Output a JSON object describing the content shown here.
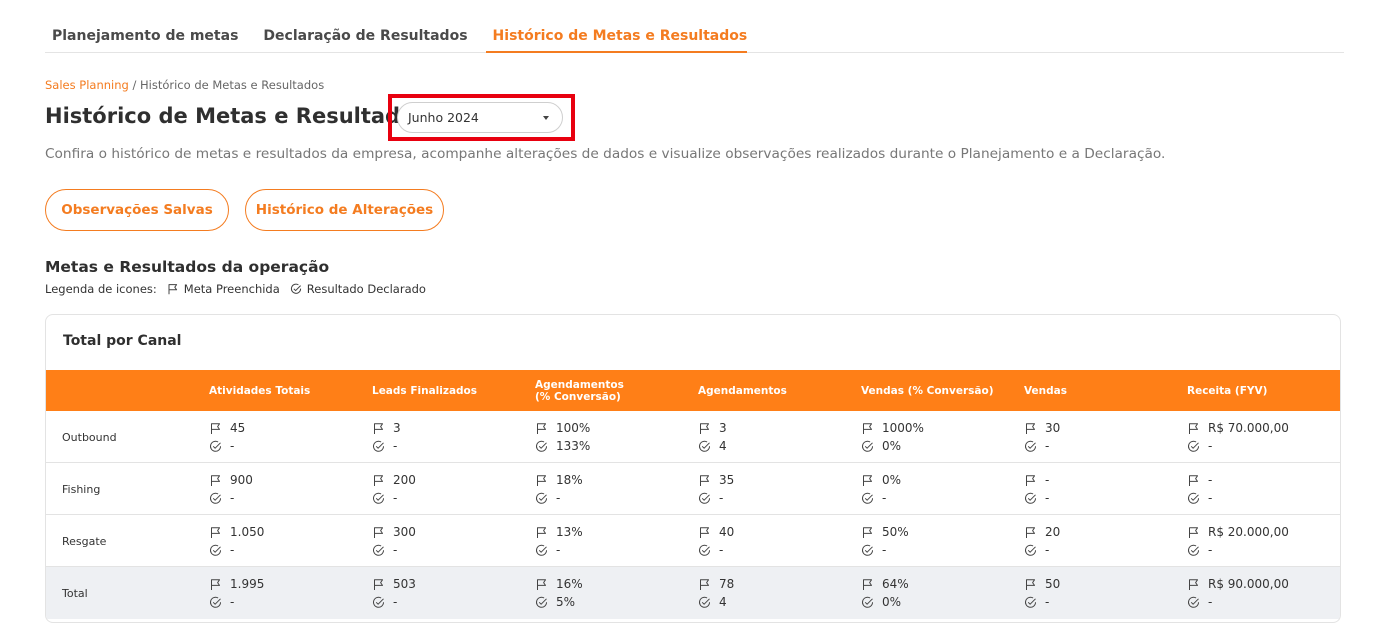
{
  "tabs": [
    {
      "label": "Planejamento de metas",
      "active": false
    },
    {
      "label": "Declaração de Resultados",
      "active": false
    },
    {
      "label": "Histórico de Metas e Resultados",
      "active": true
    }
  ],
  "breadcrumb": {
    "link": "Sales Planning",
    "separator": " / ",
    "current": "Histórico de Metas e Resultados"
  },
  "page": {
    "title": "Histórico de Metas e Resultados",
    "period_select": {
      "value": "Junho 2024"
    },
    "subtitle": "Confira o histórico de metas e resultados da empresa, acompanhe alterações de dados e visualize observações realizados durante o Planejamento e a Declaração."
  },
  "buttons": {
    "observacoes": "Observações Salvas",
    "historico": "Histórico de Alterações"
  },
  "section": {
    "title": "Metas e Resultados da operação",
    "legend_label": "Legenda de icones:",
    "legend_meta": "Meta Preenchida",
    "legend_resultado": "Resultado Declarado"
  },
  "table": {
    "title": "Total por Canal",
    "columns": [
      "Atividades Totais",
      "Leads Finalizados",
      [
        "Agendamentos",
        "(% Conversão)"
      ],
      "Agendamentos",
      "Vendas (% Conversão)",
      "Vendas",
      "Receita (FYV)"
    ],
    "rows": [
      {
        "label": "Outbound",
        "cells": [
          {
            "meta": "45",
            "resultado": "-"
          },
          {
            "meta": "3",
            "resultado": "-"
          },
          {
            "meta": "100%",
            "resultado": "133%"
          },
          {
            "meta": "3",
            "resultado": "4"
          },
          {
            "meta": "1000%",
            "resultado": "0%"
          },
          {
            "meta": "30",
            "resultado": "-"
          },
          {
            "meta": "R$ 70.000,00",
            "resultado": "-"
          }
        ]
      },
      {
        "label": "Fishing",
        "cells": [
          {
            "meta": "900",
            "resultado": "-"
          },
          {
            "meta": "200",
            "resultado": "-"
          },
          {
            "meta": "18%",
            "resultado": "-"
          },
          {
            "meta": "35",
            "resultado": "-"
          },
          {
            "meta": "0%",
            "resultado": "-"
          },
          {
            "meta": "-",
            "resultado": "-"
          },
          {
            "meta": "-",
            "resultado": "-"
          }
        ]
      },
      {
        "label": "Resgate",
        "cells": [
          {
            "meta": "1.050",
            "resultado": "-"
          },
          {
            "meta": "300",
            "resultado": "-"
          },
          {
            "meta": "13%",
            "resultado": "-"
          },
          {
            "meta": "40",
            "resultado": "-"
          },
          {
            "meta": "50%",
            "resultado": "-"
          },
          {
            "meta": "20",
            "resultado": "-"
          },
          {
            "meta": "R$ 20.000,00",
            "resultado": "-"
          }
        ]
      }
    ],
    "total": {
      "label": "Total",
      "cells": [
        {
          "meta": "1.995",
          "resultado": "-"
        },
        {
          "meta": "503",
          "resultado": "-"
        },
        {
          "meta": "16%",
          "resultado": "5%"
        },
        {
          "meta": "78",
          "resultado": "4"
        },
        {
          "meta": "64%",
          "resultado": "0%"
        },
        {
          "meta": "50",
          "resultado": "-"
        },
        {
          "meta": "R$ 90.000,00",
          "resultado": "-"
        }
      ]
    }
  },
  "colors": {
    "accent": "#f47c20",
    "header_bg": "#ff7f17",
    "highlight": "#e8000f"
  },
  "icons": {
    "meta": "flag-icon",
    "resultado": "check-circle-icon",
    "dropdown": "caret-down-icon"
  }
}
